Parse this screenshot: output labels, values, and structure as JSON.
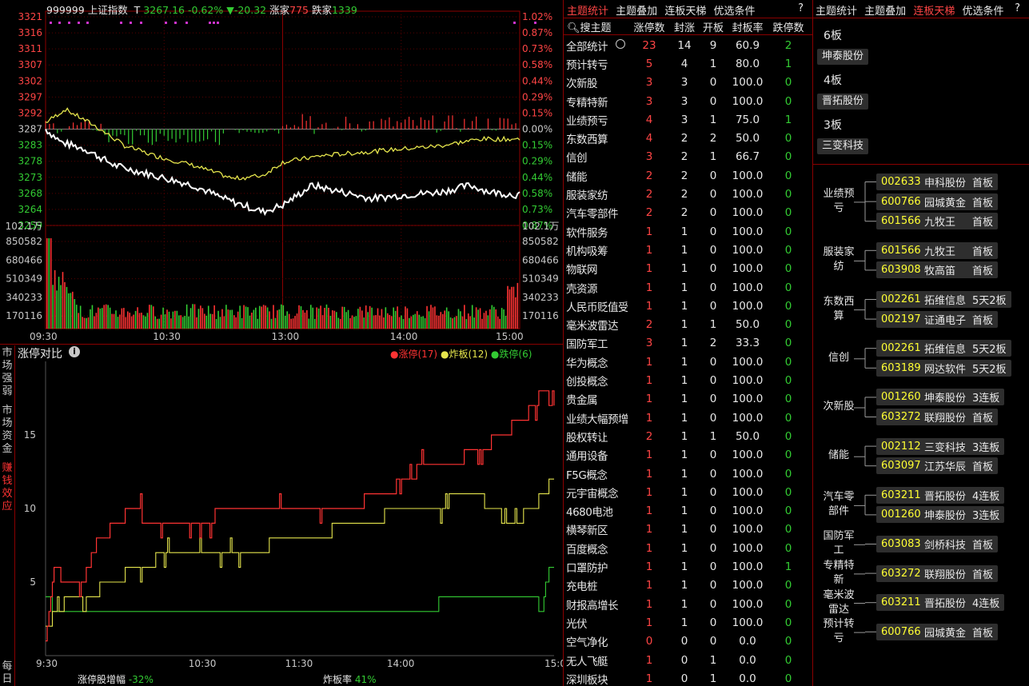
{
  "index_header": {
    "code": "999999",
    "name": "上证指数",
    "t_label": "T",
    "price": "3267.16",
    "pct": "-0.62%",
    "chg": "▼-20.32",
    "up_label": "涨家",
    "up_count": "775",
    "down_label": "跌家",
    "down_count": "1339"
  },
  "price_axis_left": [
    "3321",
    "3316",
    "3311",
    "3307",
    "3302",
    "3297",
    "3292",
    "3287",
    "3283",
    "3278",
    "3273",
    "3268",
    "3264",
    "3259"
  ],
  "pct_axis_right": [
    "1.02%",
    "0.87%",
    "0.73%",
    "0.58%",
    "0.44%",
    "0.29%",
    "0.15%",
    "0.00%",
    "0.15%",
    "0.29%",
    "0.44%",
    "0.58%",
    "0.73%",
    "0.87%"
  ],
  "vol_top_label": "102.1万",
  "vol_axis": [
    "850582",
    "680466",
    "510349",
    "340233",
    "170116"
  ],
  "time_axis": [
    "09:30",
    "10:30",
    "13:00",
    "14:00",
    "15:00"
  ],
  "cmp_panel": {
    "title": "涨停对比",
    "info_icon": "info-icon",
    "legend": [
      {
        "label": "涨停(17)",
        "color": "#ff3333"
      },
      {
        "label": "炸板(12)",
        "color": "#e6e64d"
      },
      {
        "label": "跌停(6)",
        "color": "#33cc33"
      }
    ],
    "y_ticks": [
      "15",
      "10",
      "5"
    ],
    "x_ticks": [
      "9:30",
      "10:30",
      "11:30",
      "14:00",
      "15:00"
    ],
    "footer_left_label": "涨停股增幅",
    "footer_left_value": "-32%",
    "footer_right_label": "炸板率",
    "footer_right_value": "41%"
  },
  "side_tabs": [
    {
      "text": "市场强弱",
      "active": false
    },
    {
      "text": "市场资金",
      "active": false
    },
    {
      "text": "赚钱效应",
      "active": true
    },
    {
      "text": "每日",
      "active": false
    }
  ],
  "theme_tabs": [
    "主题统计",
    "主题叠加",
    "连板天梯",
    "优选条件",
    "?"
  ],
  "theme_headers": [
    "搜主题",
    "涨停数",
    "封涨",
    "开板",
    "封板率",
    "跌停数"
  ],
  "theme_rows": [
    [
      "全部统计",
      "23",
      "14",
      "9",
      "60.9",
      "2"
    ],
    [
      "预计转亏",
      "5",
      "4",
      "1",
      "80.0",
      "1"
    ],
    [
      "次新股",
      "3",
      "3",
      "0",
      "100.0",
      "0"
    ],
    [
      "专精特新",
      "3",
      "3",
      "0",
      "100.0",
      "0"
    ],
    [
      "业绩预亏",
      "4",
      "3",
      "1",
      "75.0",
      "1"
    ],
    [
      "东数西算",
      "4",
      "2",
      "2",
      "50.0",
      "0"
    ],
    [
      "信创",
      "3",
      "2",
      "1",
      "66.7",
      "0"
    ],
    [
      "储能",
      "2",
      "2",
      "0",
      "100.0",
      "0"
    ],
    [
      "服装家纺",
      "2",
      "2",
      "0",
      "100.0",
      "0"
    ],
    [
      "汽车零部件",
      "2",
      "2",
      "0",
      "100.0",
      "0"
    ],
    [
      "软件服务",
      "1",
      "1",
      "0",
      "100.0",
      "0"
    ],
    [
      "机构吸筹",
      "1",
      "1",
      "0",
      "100.0",
      "0"
    ],
    [
      "物联网",
      "1",
      "1",
      "0",
      "100.0",
      "0"
    ],
    [
      "壳资源",
      "1",
      "1",
      "0",
      "100.0",
      "0"
    ],
    [
      "人民币贬值受益",
      "1",
      "1",
      "0",
      "100.0",
      "0"
    ],
    [
      "毫米波雷达",
      "2",
      "1",
      "1",
      "50.0",
      "0"
    ],
    [
      "国防军工",
      "3",
      "1",
      "2",
      "33.3",
      "0"
    ],
    [
      "华为概念",
      "1",
      "1",
      "0",
      "100.0",
      "0"
    ],
    [
      "创投概念",
      "1",
      "1",
      "0",
      "100.0",
      "0"
    ],
    [
      "贵金属",
      "1",
      "1",
      "0",
      "100.0",
      "0"
    ],
    [
      "业绩大幅预增",
      "1",
      "1",
      "0",
      "100.0",
      "0"
    ],
    [
      "股权转让",
      "2",
      "1",
      "1",
      "50.0",
      "0"
    ],
    [
      "通用设备",
      "1",
      "1",
      "0",
      "100.0",
      "0"
    ],
    [
      "F5G概念",
      "1",
      "1",
      "0",
      "100.0",
      "0"
    ],
    [
      "元宇宙概念",
      "1",
      "1",
      "0",
      "100.0",
      "0"
    ],
    [
      "4680电池",
      "1",
      "1",
      "0",
      "100.0",
      "0"
    ],
    [
      "横琴新区",
      "1",
      "1",
      "0",
      "100.0",
      "0"
    ],
    [
      "百度概念",
      "1",
      "1",
      "0",
      "100.0",
      "0"
    ],
    [
      "口罩防护",
      "1",
      "1",
      "0",
      "100.0",
      "1"
    ],
    [
      "充电桩",
      "1",
      "1",
      "0",
      "100.0",
      "0"
    ],
    [
      "财报高增长",
      "1",
      "1",
      "0",
      "100.0",
      "0"
    ],
    [
      "光伏",
      "1",
      "1",
      "0",
      "100.0",
      "0"
    ],
    [
      "空气净化",
      "0",
      "0",
      "0",
      "0.0",
      "0"
    ],
    [
      "无人飞艇",
      "1",
      "0",
      "1",
      "0.0",
      "0"
    ],
    [
      "深圳板块",
      "1",
      "0",
      "1",
      "0.0",
      "0"
    ]
  ],
  "ladder_tabs": [
    "主题统计",
    "主题叠加",
    "连板天梯",
    "优选条件",
    "?"
  ],
  "ladder": [
    {
      "level": "6板",
      "stocks": [
        "坤泰股份"
      ]
    },
    {
      "level": "4板",
      "stocks": [
        "晋拓股份"
      ]
    },
    {
      "level": "3板",
      "stocks": [
        "三变科技"
      ]
    }
  ],
  "sector_groups": [
    {
      "name": "业绩预亏",
      "items": [
        [
          "002633",
          "申科股份",
          "首板"
        ],
        [
          "600766",
          "园城黄金",
          "首板"
        ],
        [
          "601566",
          "九牧王",
          "首板"
        ]
      ]
    },
    {
      "name": "服装家纺",
      "items": [
        [
          "601566",
          "九牧王",
          "首板"
        ],
        [
          "603908",
          "牧高笛",
          "首板"
        ]
      ]
    },
    {
      "name": "东数西算",
      "items": [
        [
          "002261",
          "拓维信息",
          "5天2板"
        ],
        [
          "002197",
          "证通电子",
          "首板"
        ]
      ]
    },
    {
      "name": "信创",
      "items": [
        [
          "002261",
          "拓维信息",
          "5天2板"
        ],
        [
          "603189",
          "网达软件",
          "5天2板"
        ]
      ]
    },
    {
      "name": "次新股",
      "items": [
        [
          "001260",
          "坤泰股份",
          "3连板"
        ],
        [
          "603272",
          "联翔股份",
          "首板"
        ]
      ]
    },
    {
      "name": "储能",
      "items": [
        [
          "002112",
          "三变科技",
          "3连板"
        ],
        [
          "603097",
          "江苏华辰",
          "首板"
        ]
      ]
    },
    {
      "name": "汽车零部件",
      "items": [
        [
          "603211",
          "晋拓股份",
          "4连板"
        ],
        [
          "001260",
          "坤泰股份",
          "3连板"
        ]
      ]
    },
    {
      "name": "国防军工",
      "items": [
        [
          "603083",
          "剑桥科技",
          "首板"
        ]
      ]
    },
    {
      "name": "专精特新",
      "items": [
        [
          "603272",
          "联翔股份",
          "首板"
        ]
      ]
    },
    {
      "name": "毫米波雷达",
      "items": [
        [
          "603211",
          "晋拓股份",
          "4连板"
        ]
      ]
    },
    {
      "name": "预计转亏",
      "items": [
        [
          "600766",
          "园城黄金",
          "首板"
        ]
      ]
    }
  ]
}
